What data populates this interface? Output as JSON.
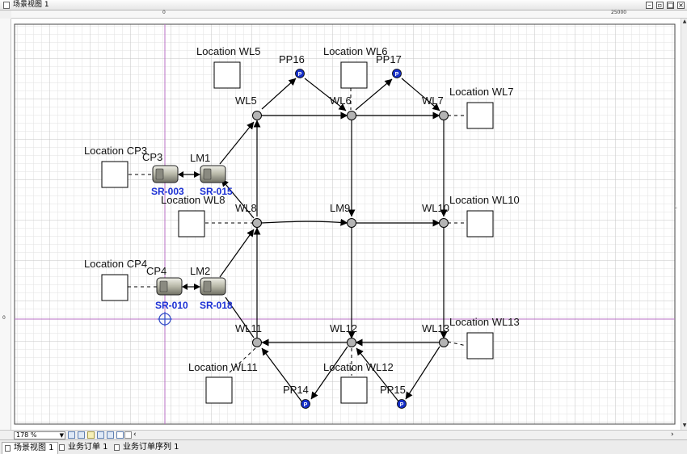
{
  "window": {
    "title": "场景视图 1"
  },
  "ruler": {
    "top_labels": [
      "0",
      "25000"
    ],
    "left_labels": [
      "0"
    ]
  },
  "colors": {
    "grid_minor": "#dcdcdc",
    "grid_major": "#c0c0c0",
    "axis": "#b86fc4",
    "point_fill": "#b4b4b4",
    "pp_fill": "#1730c8",
    "vehicle_label": "#1a2fd4"
  },
  "locations": {
    "wl5": "Location WL5",
    "wl6": "Location WL6",
    "wl7": "Location WL7",
    "cp3": "Location CP3",
    "wl8": "Location WL8",
    "wl10": "Location WL10",
    "cp4": "Location CP4",
    "wl13": "Location WL13",
    "wl11": "Location WL11",
    "wl12": "Location WL12"
  },
  "points": {
    "wl5": "WL5",
    "wl6": "WL6",
    "wl7": "WL7",
    "wl8": "WL8",
    "lm9": "LM9",
    "wl10": "WL10",
    "wl11": "WL11",
    "wl12": "WL12",
    "wl13": "WL13",
    "lm1": "LM1",
    "lm2": "LM2",
    "cp3": "CP3",
    "cp4": "CP4",
    "pp16": "PP16",
    "pp17": "PP17",
    "pp14": "PP14",
    "pp15": "PP15"
  },
  "pp_glyph": "P",
  "vehicles": {
    "sr003": "SR-003",
    "sr015": "SR-015",
    "sr010": "SR-010",
    "sr018": "SR-018"
  },
  "bottombar": {
    "zoom": "178 %",
    "icons": [
      "pointer-icon",
      "save-icon",
      "grid-icon",
      "layer-icon",
      "pen-icon",
      "link-icon"
    ]
  },
  "tabs": [
    {
      "label": "场景视图 1",
      "active": true
    },
    {
      "label": "业务订单 1",
      "active": false
    },
    {
      "label": "业务订单序列 1",
      "active": false
    }
  ]
}
